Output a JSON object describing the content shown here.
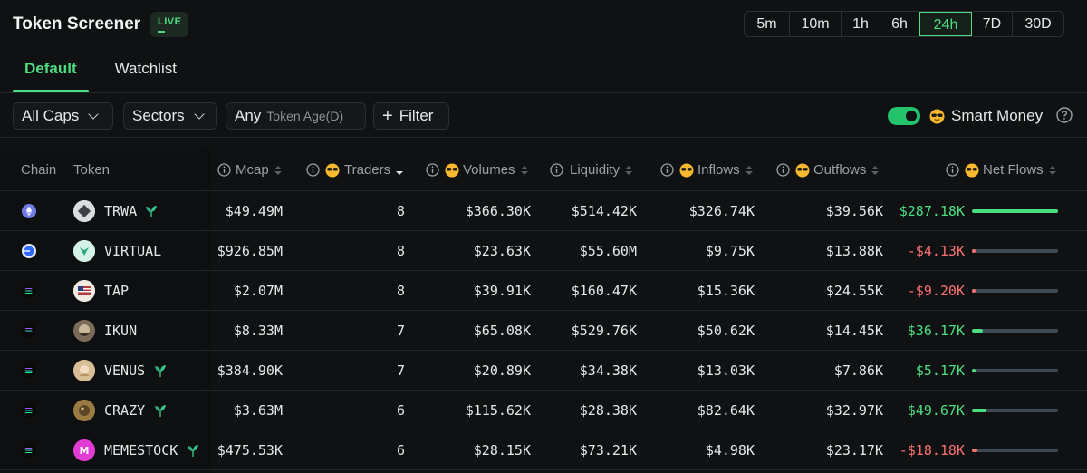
{
  "header": {
    "title": "Token Screener",
    "live_badge": "LIVE",
    "timeframes": [
      "5m",
      "10m",
      "1h",
      "6h",
      "24h",
      "7D",
      "30D"
    ],
    "active_timeframe": "24h"
  },
  "tabs": [
    {
      "label": "Default",
      "active": true
    },
    {
      "label": "Watchlist",
      "active": false
    }
  ],
  "filters": {
    "caps_label": "All Caps",
    "sectors_label": "Sectors",
    "age_any": "Any",
    "age_placeholder": "Token Age(D)",
    "filter_label": "Filter",
    "smart_money_label": "Smart Money",
    "smart_money_on": true
  },
  "table": {
    "columns": {
      "chain": "Chain",
      "token": "Token",
      "mcap": "Mcap",
      "traders": "Traders",
      "volumes": "Volumes",
      "liquidity": "Liquidity",
      "inflows": "Inflows",
      "outflows": "Outflows",
      "net_flows": "Net Flows"
    },
    "sorted_by": "traders",
    "rows": [
      {
        "chain": "ethereum",
        "token": "TRWA",
        "sprout": true,
        "mcap": "$49.49M",
        "traders": "8",
        "volumes": "$366.30K",
        "liquidity": "$514.42K",
        "inflows": "$326.74K",
        "outflows": "$39.56K",
        "net_flows": "$287.18K",
        "net_sign": "pos",
        "net_fraction": 1.0
      },
      {
        "chain": "base",
        "token": "VIRTUAL",
        "sprout": false,
        "mcap": "$926.85M",
        "traders": "8",
        "volumes": "$23.63K",
        "liquidity": "$55.60M",
        "inflows": "$9.75K",
        "outflows": "$13.88K",
        "net_flows": "-$4.13K",
        "net_sign": "neg",
        "net_fraction": 0.014
      },
      {
        "chain": "solana",
        "token": "TAP",
        "sprout": false,
        "mcap": "$2.07M",
        "traders": "8",
        "volumes": "$39.91K",
        "liquidity": "$160.47K",
        "inflows": "$15.36K",
        "outflows": "$24.55K",
        "net_flows": "-$9.20K",
        "net_sign": "neg",
        "net_fraction": 0.032
      },
      {
        "chain": "solana",
        "token": "IKUN",
        "sprout": false,
        "mcap": "$8.33M",
        "traders": "7",
        "volumes": "$65.08K",
        "liquidity": "$529.76K",
        "inflows": "$50.62K",
        "outflows": "$14.45K",
        "net_flows": "$36.17K",
        "net_sign": "pos",
        "net_fraction": 0.126
      },
      {
        "chain": "solana",
        "token": "VENUS",
        "sprout": true,
        "mcap": "$384.90K",
        "traders": "7",
        "volumes": "$20.89K",
        "liquidity": "$34.38K",
        "inflows": "$13.03K",
        "outflows": "$7.86K",
        "net_flows": "$5.17K",
        "net_sign": "pos",
        "net_fraction": 0.018
      },
      {
        "chain": "solana",
        "token": "CRAZY",
        "sprout": true,
        "mcap": "$3.63M",
        "traders": "6",
        "volumes": "$115.62K",
        "liquidity": "$28.38K",
        "inflows": "$82.64K",
        "outflows": "$32.97K",
        "net_flows": "$49.67K",
        "net_sign": "pos",
        "net_fraction": 0.173
      },
      {
        "chain": "solana",
        "token": "MEMESTOCK",
        "sprout": true,
        "mcap": "$475.53K",
        "traders": "6",
        "volumes": "$28.15K",
        "liquidity": "$73.21K",
        "inflows": "$4.98K",
        "outflows": "$23.17K",
        "net_flows": "-$18.18K",
        "net_sign": "neg",
        "net_fraction": 0.063
      }
    ]
  },
  "colors": {
    "accent": "#4ade80",
    "negative": "#f87171",
    "bar_track": "#3b4a55",
    "background": "#0f1112"
  }
}
